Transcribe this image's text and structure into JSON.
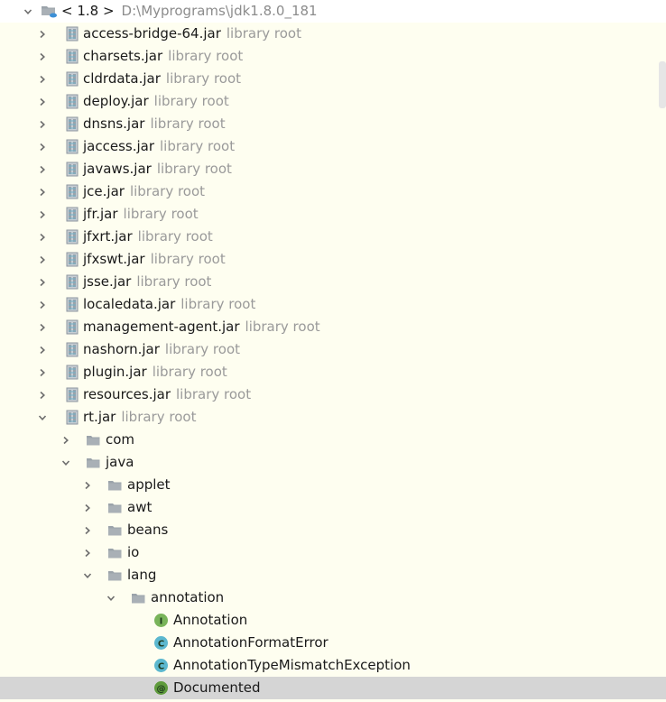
{
  "colors": {
    "background": "#fefef0",
    "selected_row": "#d5d5d5",
    "hint_text": "#9a9a9a",
    "interface_icon": "#79b45a",
    "class_icon": "#5cb8cf",
    "annotation_icon": "#5f9b3c",
    "folder_icon": "#9ba3aa"
  },
  "root": {
    "label": "< 1.8 >",
    "path": "D:\\Myprograms\\jdk1.8.0_181",
    "icon": "jdk-folder-icon"
  },
  "jars": [
    {
      "name": "access-bridge-64.jar",
      "hint": "library root"
    },
    {
      "name": "charsets.jar",
      "hint": "library root"
    },
    {
      "name": "cldrdata.jar",
      "hint": "library root"
    },
    {
      "name": "deploy.jar",
      "hint": "library root"
    },
    {
      "name": "dnsns.jar",
      "hint": "library root"
    },
    {
      "name": "jaccess.jar",
      "hint": "library root"
    },
    {
      "name": "javaws.jar",
      "hint": "library root"
    },
    {
      "name": "jce.jar",
      "hint": "library root"
    },
    {
      "name": "jfr.jar",
      "hint": "library root"
    },
    {
      "name": "jfxrt.jar",
      "hint": "library root"
    },
    {
      "name": "jfxswt.jar",
      "hint": "library root"
    },
    {
      "name": "jsse.jar",
      "hint": "library root"
    },
    {
      "name": "localedata.jar",
      "hint": "library root"
    },
    {
      "name": "management-agent.jar",
      "hint": "library root"
    },
    {
      "name": "nashorn.jar",
      "hint": "library root"
    },
    {
      "name": "plugin.jar",
      "hint": "library root"
    },
    {
      "name": "resources.jar",
      "hint": "library root"
    },
    {
      "name": "rt.jar",
      "hint": "library root",
      "expanded": true
    }
  ],
  "rt_tree": [
    {
      "name": "com",
      "kind": "package",
      "level": 2,
      "expanded": false
    },
    {
      "name": "java",
      "kind": "package",
      "level": 2,
      "expanded": true
    },
    {
      "name": "applet",
      "kind": "package",
      "level": 3,
      "expanded": false
    },
    {
      "name": "awt",
      "kind": "package",
      "level": 3,
      "expanded": false
    },
    {
      "name": "beans",
      "kind": "package",
      "level": 3,
      "expanded": false
    },
    {
      "name": "io",
      "kind": "package",
      "level": 3,
      "expanded": false
    },
    {
      "name": "lang",
      "kind": "package",
      "level": 3,
      "expanded": true
    },
    {
      "name": "annotation",
      "kind": "package",
      "level": 4,
      "expanded": true
    },
    {
      "name": "Annotation",
      "kind": "interface",
      "level": 5,
      "icon_letter": "I"
    },
    {
      "name": "AnnotationFormatError",
      "kind": "class",
      "level": 5,
      "icon_letter": "C"
    },
    {
      "name": "AnnotationTypeMismatchException",
      "kind": "class",
      "level": 5,
      "icon_letter": "C"
    },
    {
      "name": "Documented",
      "kind": "annotation",
      "level": 5,
      "icon_letter": "@",
      "selected": true
    }
  ]
}
